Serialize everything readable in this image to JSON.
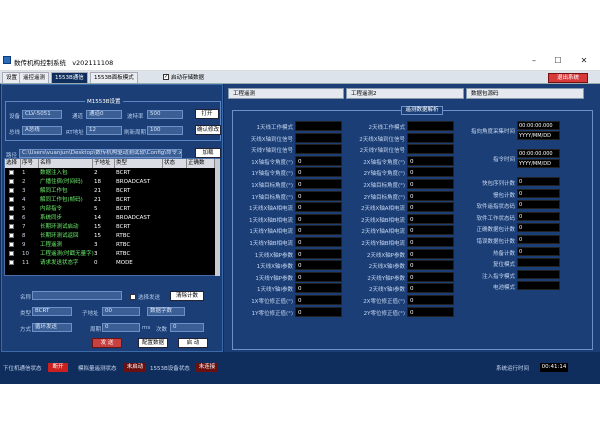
{
  "window": {
    "title": "数传机构控制系统",
    "version": "v202111108"
  },
  "tabs": [
    {
      "label": "设置"
    },
    {
      "label": "遥控遥测"
    },
    {
      "label": "1553B通信"
    },
    {
      "label": "1553B面板模式"
    }
  ],
  "store_checkbox": {
    "label": "启动存储数据",
    "checked": "✓"
  },
  "exit_label": "退出系统",
  "m_group_title": "M1553B设置",
  "board_label": "设备",
  "board_value": "CLV-5051",
  "channel_label": "通道",
  "channel_value": "通道0",
  "baud_label": "波特率",
  "baud_value": "500",
  "open_label": "打开",
  "mode_label": "总线",
  "mode_value": "A总线",
  "rt_label": "RT地址",
  "rt_value": "12",
  "period_label": "刷新周期",
  "period_value": "100",
  "confirm_label": "确认修改",
  "path_label": "路径",
  "path_value": "C:\\Users\\vuanjun\\Desktop\\数传机构驱动测试软\\Config\\命令.xlsx",
  "load_label": "加载",
  "table": {
    "headers": [
      "选择",
      "序号",
      "名称",
      "子地址",
      "类型",
      "状态",
      "正确数"
    ],
    "rows": [
      {
        "n": "1",
        "name": "数据注入包",
        "sa": "2",
        "type": "BCRT"
      },
      {
        "n": "2",
        "name": "广播住宿(时间码)",
        "sa": "18",
        "type": "BROADCAST"
      },
      {
        "n": "3",
        "name": "解同工作包",
        "sa": "21",
        "type": "BCRT"
      },
      {
        "n": "4",
        "name": "解同工作包(帧码)",
        "sa": "21",
        "type": "BCRT"
      },
      {
        "n": "5",
        "name": "内部指令",
        "sa": "5",
        "type": "BCRT"
      },
      {
        "n": "6",
        "name": "系统同步",
        "sa": "14",
        "type": "BROADCAST"
      },
      {
        "n": "7",
        "name": "长期环测试启动",
        "sa": "15",
        "type": "BCRT"
      },
      {
        "n": "8",
        "name": "长期环测试返回",
        "sa": "15",
        "type": "RTBC"
      },
      {
        "n": "9",
        "name": "工程遥测",
        "sa": "3",
        "type": "RTBC"
      },
      {
        "n": "10",
        "name": "工程遥测(时戳无量字)",
        "sa": "3",
        "type": "RTBC"
      },
      {
        "n": "11",
        "name": "请求发送状态字",
        "sa": "0",
        "type": "MODE"
      }
    ]
  },
  "send": {
    "name_label": "名称",
    "cycle_label": "选择发送",
    "clear_label": "清除计数",
    "type_label": "类型",
    "type_value": "BCRT",
    "sub_label": "子地址",
    "sub_value": "00",
    "count_label": "数据字数",
    "count_value": "数据字数",
    "mode_label": "方式",
    "mode_value": "循环发送",
    "period_label": "周期",
    "period_value": "0",
    "unit": "ms",
    "times_label": "次数",
    "times_value": "0",
    "send_label": "发 送",
    "config_label": "配置数据",
    "start_label": "启 动"
  },
  "rtabs": [
    "工程遥测",
    "工程遥测2",
    "数据包源码"
  ],
  "panel_title": "遥测数据解析",
  "col1": [
    "1天线工作模式",
    "天线X轴到位信号",
    "天线Y轴到位信号",
    "1X轴指令角度(°)",
    "1Y轴指令角度(°)",
    "1X轴目标角度(°)",
    "1Y轴目标角度(°)",
    "1天线X轴A相电流",
    "1天线X轴B相电流",
    "1天线Y轴A相电流",
    "1天线Y轴B相电流",
    "1天线X轴P参数",
    "1天线X轴I参数",
    "1天线Y轴P参数",
    "1天线Y轴I参数",
    "1X零位修正值(°)",
    "1Y零位修正值(°)"
  ],
  "col2": [
    "2天线工作模式",
    "2天线X轴到位信号",
    "2天线Y轴到位信号",
    "2X轴指令角度(°)",
    "2Y轴指令角度(°)",
    "2X轴目标角度(°)",
    "2Y轴目标角度(°)",
    "2天线X轴A相电流",
    "2天线X轴B相电流",
    "2天线Y轴A相电流",
    "2天线Y轴B相电流",
    "2天线X轴P参数",
    "2天线X轴I参数",
    "2天线Y轴P参数",
    "2天线Y轴I参数",
    "2X零位修正值(°)",
    "2Y零位修正值(°)"
  ],
  "zero": "0",
  "col3_time": [
    {
      "label": "指向角度采集时间",
      "v1": "00:00:00.000",
      "v2": "YYYY/MM/DD"
    },
    {
      "label": "指令时间",
      "v1": "00:00:00.000",
      "v2": "YYYY/MM/DD"
    }
  ],
  "col3": [
    "快包序列计数",
    "慢包计数",
    "软件遥指状态码",
    "软件工作状态码",
    "正确数据包计数",
    "错误数据包计数",
    "热备计数",
    "复位模式",
    "注入指令模式",
    "电池模式"
  ],
  "status": {
    "lower_label": "下位机通信状态",
    "lower_value": "断开",
    "lower_color": "#c92020",
    "analog_label": "模拟量遥测状态",
    "analog_value": "未启动",
    "analog_color": "#6a1010",
    "bus_label": "1553B设备状态",
    "bus_value": "未连接",
    "bus_color": "#6a1010",
    "run_label": "系统运行时间",
    "run_value": "00:41:14"
  }
}
